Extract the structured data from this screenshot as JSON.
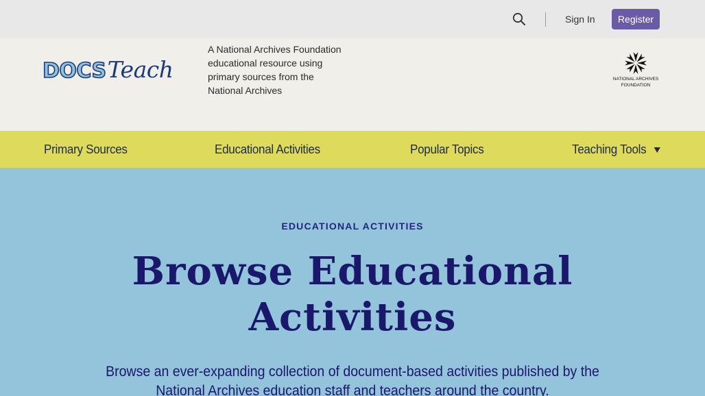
{
  "utility": {
    "search_icon": "search-icon",
    "signin_label": "Sign In",
    "register_label": "Register"
  },
  "header": {
    "logo_docs": "DOCS",
    "logo_teach": "Teach",
    "tagline": "A National Archives Foundation educational resource using primary sources from the National Archives",
    "partner_logo_text_line1": "NATIONAL ARCHIVES",
    "partner_logo_text_line2": "FOUNDATION"
  },
  "nav": {
    "items": [
      {
        "label": "Primary Sources"
      },
      {
        "label": "Educational Activities"
      },
      {
        "label": "Popular Topics"
      },
      {
        "label": "Teaching Tools"
      }
    ]
  },
  "hero": {
    "eyebrow": "EDUCATIONAL ACTIVITIES",
    "title": "Browse Educational Activities",
    "description": "Browse an ever-expanding collection of document-based activities published by the National Archives education staff and teachers around the country."
  },
  "colors": {
    "utility_bg": "#e8e8e8",
    "header_bg": "#f0efe9",
    "nav_bg": "#dedb5c",
    "hero_bg": "#94c4dc",
    "register_bg": "#6b5ba6",
    "title_color": "#19186a"
  }
}
